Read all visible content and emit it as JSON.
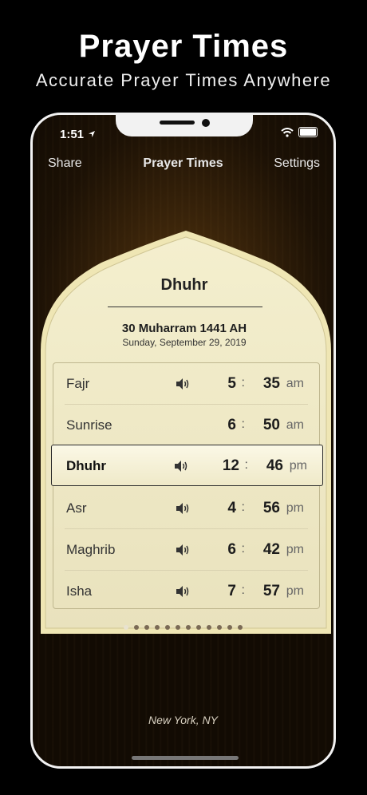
{
  "promo": {
    "title": "Prayer Times",
    "subtitle": "Accurate Prayer Times Anywhere"
  },
  "status_bar": {
    "time": "1:51"
  },
  "navbar": {
    "share": "Share",
    "title": "Prayer Times",
    "settings": "Settings"
  },
  "card": {
    "current_prayer": "Dhuhr",
    "hijri_date": "30 Muharram 1441 AH",
    "gregorian_date": "Sunday, September 29, 2019"
  },
  "prayers": [
    {
      "name": "Fajr",
      "hour": "5",
      "minute": "35",
      "ampm": "am",
      "sound": true
    },
    {
      "name": "Sunrise",
      "hour": "6",
      "minute": "50",
      "ampm": "am",
      "sound": false
    },
    {
      "name": "Dhuhr",
      "hour": "12",
      "minute": "46",
      "ampm": "pm",
      "sound": true,
      "active": true
    },
    {
      "name": "Asr",
      "hour": "4",
      "minute": "56",
      "ampm": "pm",
      "sound": true
    },
    {
      "name": "Maghrib",
      "hour": "6",
      "minute": "42",
      "ampm": "pm",
      "sound": true
    },
    {
      "name": "Isha",
      "hour": "7",
      "minute": "57",
      "ampm": "pm",
      "sound": true
    }
  ],
  "time_separator": ":",
  "page_indicator": {
    "count": 12,
    "current": 1
  },
  "location": "New York, NY",
  "colors": {
    "card": "#f5f0cf",
    "card_border": "#d8cf9e",
    "background": "#2a1a07"
  }
}
